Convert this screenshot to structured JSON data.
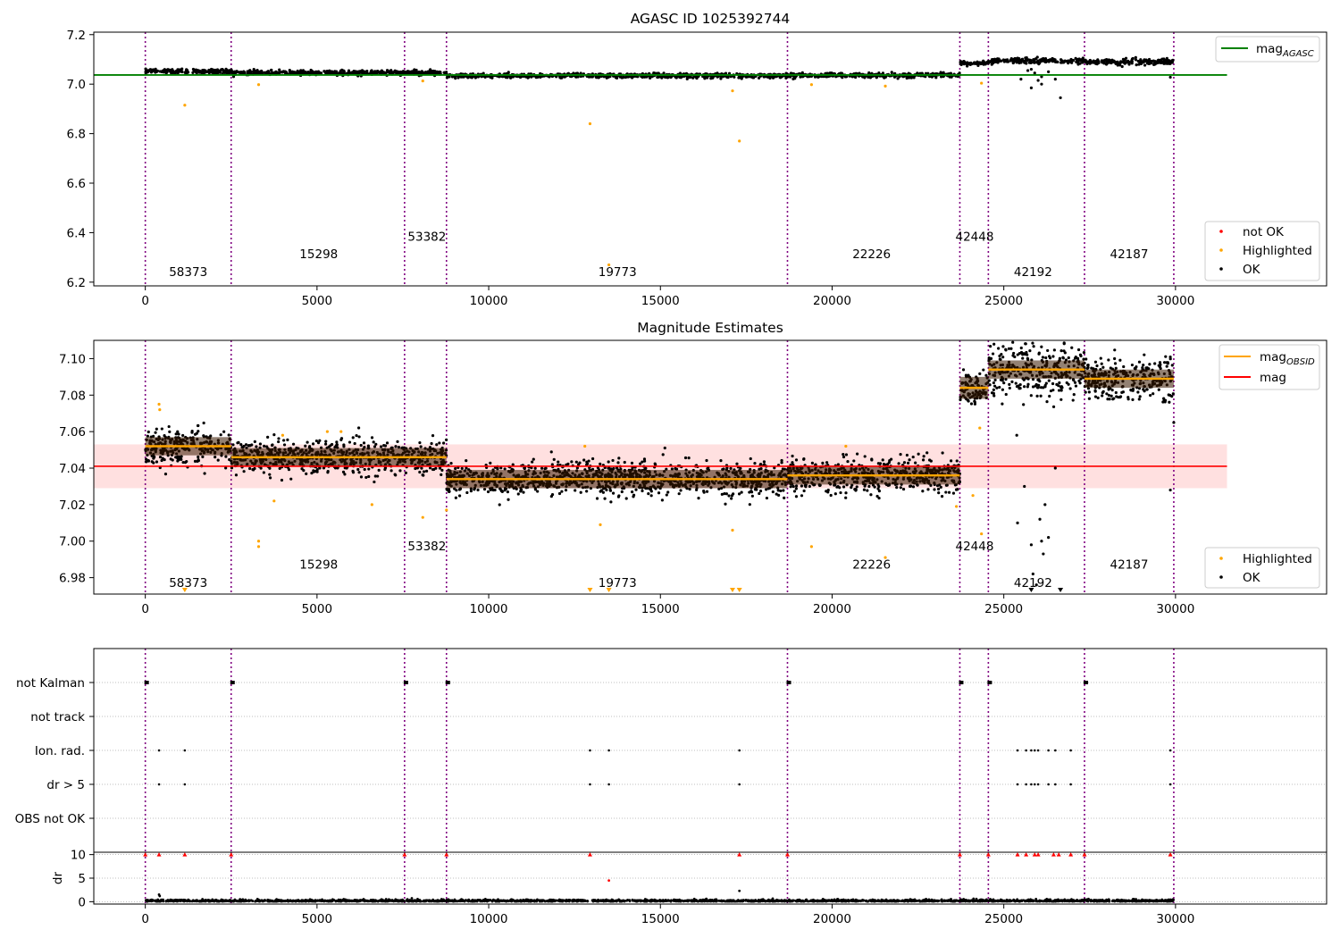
{
  "figure": {
    "panel1": {
      "title": "AGASC ID 1025392744",
      "xticks": [
        0,
        5000,
        10000,
        15000,
        20000,
        25000,
        30000
      ],
      "yticks": [
        "6.2",
        "6.4",
        "6.6",
        "6.8",
        "7.0",
        "7.2"
      ],
      "legend_line": {
        "label": "mag",
        "sub": "AGASC"
      },
      "legend_points": [
        "not OK",
        "Highlighted",
        "OK"
      ]
    },
    "panel2": {
      "title": "Magnitude Estimates",
      "xticks": [
        0,
        5000,
        10000,
        15000,
        20000,
        25000,
        30000
      ],
      "yticks": [
        "6.98",
        "7.00",
        "7.02",
        "7.04",
        "7.06",
        "7.08",
        "7.10"
      ],
      "legend_lines": [
        {
          "label": "mag",
          "sub": "OBSID"
        },
        {
          "label": "mag",
          "sub": ""
        }
      ],
      "legend_points": [
        "Highlighted",
        "OK"
      ]
    },
    "panel3": {
      "flag_labels": [
        "not Kalman",
        "not track",
        "Ion. rad.",
        "dr > 5",
        "OBS not OK"
      ],
      "dr_label": "dr",
      "dr_yticks": [
        "0",
        "5",
        "10"
      ],
      "xticks": [
        0,
        5000,
        10000,
        15000,
        20000,
        25000,
        30000
      ]
    },
    "colors": {
      "ok": "#000000",
      "highlighted": "#ffa500",
      "not_ok": "#ff0000",
      "agasc": "#008000",
      "mag": "#ff0000",
      "obsid": "#ffa500",
      "boundary": "#800080"
    }
  },
  "chart_data": [
    {
      "type": "scatter",
      "title": "AGASC ID 1025392744",
      "xlim": [
        -1500,
        34400
      ],
      "ylim": [
        6.185,
        7.21
      ],
      "mag_agasc": 7.037,
      "agasc_line_x": [
        -1500,
        31500
      ],
      "obsid_boundaries": [
        0,
        2500,
        7550,
        8770,
        18700,
        23720,
        24550,
        27350,
        29950
      ],
      "obsid_labels": [
        {
          "text": "58373",
          "x": 1250,
          "y": 6.225
        },
        {
          "text": "15298",
          "x": 5050,
          "y": 6.297
        },
        {
          "text": "53382",
          "x": 8200,
          "y": 6.368
        },
        {
          "text": "19773",
          "x": 13750,
          "y": 6.225
        },
        {
          "text": "22226",
          "x": 21150,
          "y": 6.297
        },
        {
          "text": "42448",
          "x": 24150,
          "y": 6.368
        },
        {
          "text": "42192",
          "x": 25850,
          "y": 6.225
        },
        {
          "text": "42187",
          "x": 28650,
          "y": 6.297
        }
      ],
      "segments_mag_mean": [
        {
          "x0": 0,
          "x1": 2500,
          "mean": 7.052
        },
        {
          "x0": 2500,
          "x1": 8770,
          "mean": 7.046
        },
        {
          "x0": 8770,
          "x1": 18700,
          "mean": 7.034
        },
        {
          "x0": 18700,
          "x1": 23720,
          "mean": 7.036
        },
        {
          "x0": 23720,
          "x1": 24550,
          "mean": 7.084
        },
        {
          "x0": 24550,
          "x1": 27350,
          "mean": 7.094
        },
        {
          "x0": 27350,
          "x1": 29950,
          "mean": 7.089
        }
      ],
      "highlighted_points": [
        [
          1150,
          6.915
        ],
        [
          12950,
          6.84
        ],
        [
          17300,
          6.77
        ],
        [
          13500,
          6.27
        ],
        [
          3300,
          6.998
        ],
        [
          17100,
          6.973
        ],
        [
          19400,
          6.998
        ],
        [
          21550,
          6.992
        ],
        [
          8080,
          7.013
        ],
        [
          24350,
          7.004
        ]
      ],
      "ok_outliers": [
        [
          25800,
          6.985
        ],
        [
          26650,
          6.945
        ],
        [
          26100,
          7.0
        ],
        [
          25500,
          7.02
        ],
        [
          29850,
          7.028
        ]
      ],
      "legend": [
        "not OK",
        "Highlighted",
        "OK"
      ]
    },
    {
      "type": "scatter",
      "title": "Magnitude Estimates",
      "xlim": [
        -1500,
        34400
      ],
      "ylim": [
        6.971,
        7.11
      ],
      "mag": 7.041,
      "mag_band": [
        7.029,
        7.053
      ],
      "mag_line_x": [
        -1500,
        31500
      ],
      "obsid_labels": [
        {
          "text": "58373",
          "x": 1250,
          "y": 6.975
        },
        {
          "text": "15298",
          "x": 5050,
          "y": 6.985
        },
        {
          "text": "53382",
          "x": 8200,
          "y": 6.995
        },
        {
          "text": "19773",
          "x": 13750,
          "y": 6.975
        },
        {
          "text": "22226",
          "x": 21150,
          "y": 6.985
        },
        {
          "text": "42448",
          "x": 24150,
          "y": 6.995
        },
        {
          "text": "42192",
          "x": 25850,
          "y": 6.975
        },
        {
          "text": "42187",
          "x": 28650,
          "y": 6.985
        }
      ],
      "highlighted_points": [
        [
          400,
          7.075
        ],
        [
          420,
          7.072
        ],
        [
          3300,
          7.0
        ],
        [
          3300,
          6.997
        ],
        [
          3750,
          7.022
        ],
        [
          4000,
          7.058
        ],
        [
          5300,
          7.06
        ],
        [
          5700,
          7.06
        ],
        [
          6600,
          7.02
        ],
        [
          8080,
          7.013
        ],
        [
          8770,
          7.017
        ],
        [
          12800,
          7.052
        ],
        [
          13250,
          7.009
        ],
        [
          17100,
          7.006
        ],
        [
          19400,
          6.997
        ],
        [
          20400,
          7.052
        ],
        [
          21550,
          6.991
        ],
        [
          23620,
          7.019
        ],
        [
          24100,
          7.025
        ],
        [
          24350,
          7.004
        ],
        [
          24300,
          7.062
        ]
      ],
      "highlighted_off_bottom_x": [
        1150,
        12950,
        13500,
        17100,
        17300
      ],
      "ok_off_bottom_x": [
        25800,
        26650
      ],
      "ok_scatter_points": [
        [
          25400,
          7.01
        ],
        [
          25600,
          7.03
        ],
        [
          25800,
          6.998
        ],
        [
          25850,
          6.982
        ],
        [
          25950,
          6.976
        ],
        [
          26050,
          7.012
        ],
        [
          26100,
          7.0
        ],
        [
          26150,
          6.993
        ],
        [
          26200,
          7.02
        ],
        [
          26300,
          7.002
        ],
        [
          26500,
          7.04
        ],
        [
          29850,
          7.028
        ],
        [
          29950,
          7.065
        ]
      ],
      "legend": [
        "Highlighted",
        "OK"
      ]
    },
    {
      "type": "scatter",
      "flag_rows": [
        "not Kalman",
        "not track",
        "Ion. rad.",
        "dr > 5",
        "OBS not OK"
      ],
      "not_kalman_x": [
        0,
        2500,
        7550,
        8770,
        18700,
        23720,
        24550,
        27350
      ],
      "ion_rad_x": [
        400,
        1150,
        12950,
        13500,
        17300,
        25400,
        25650,
        25800,
        25900,
        26000,
        26300,
        26500,
        26950,
        29850
      ],
      "dr_gt5_x": [
        400,
        1150,
        12950,
        13500,
        17300,
        25400,
        25650,
        25800,
        25900,
        26000,
        26300,
        26500,
        26950,
        29850
      ],
      "dr_ylim": [
        -0.5,
        10.5
      ],
      "dr_clipped_x": [
        0,
        400,
        1150,
        2500,
        7550,
        8770,
        12950,
        17300,
        18700,
        23720,
        24550,
        25400,
        25650,
        25900,
        26000,
        26450,
        26600,
        26950,
        27350,
        29850
      ],
      "dr_points": [
        [
          13500,
          4.5
        ],
        [
          17300,
          2.3
        ],
        [
          400,
          1.5
        ],
        [
          420,
          1.2
        ]
      ]
    }
  ]
}
